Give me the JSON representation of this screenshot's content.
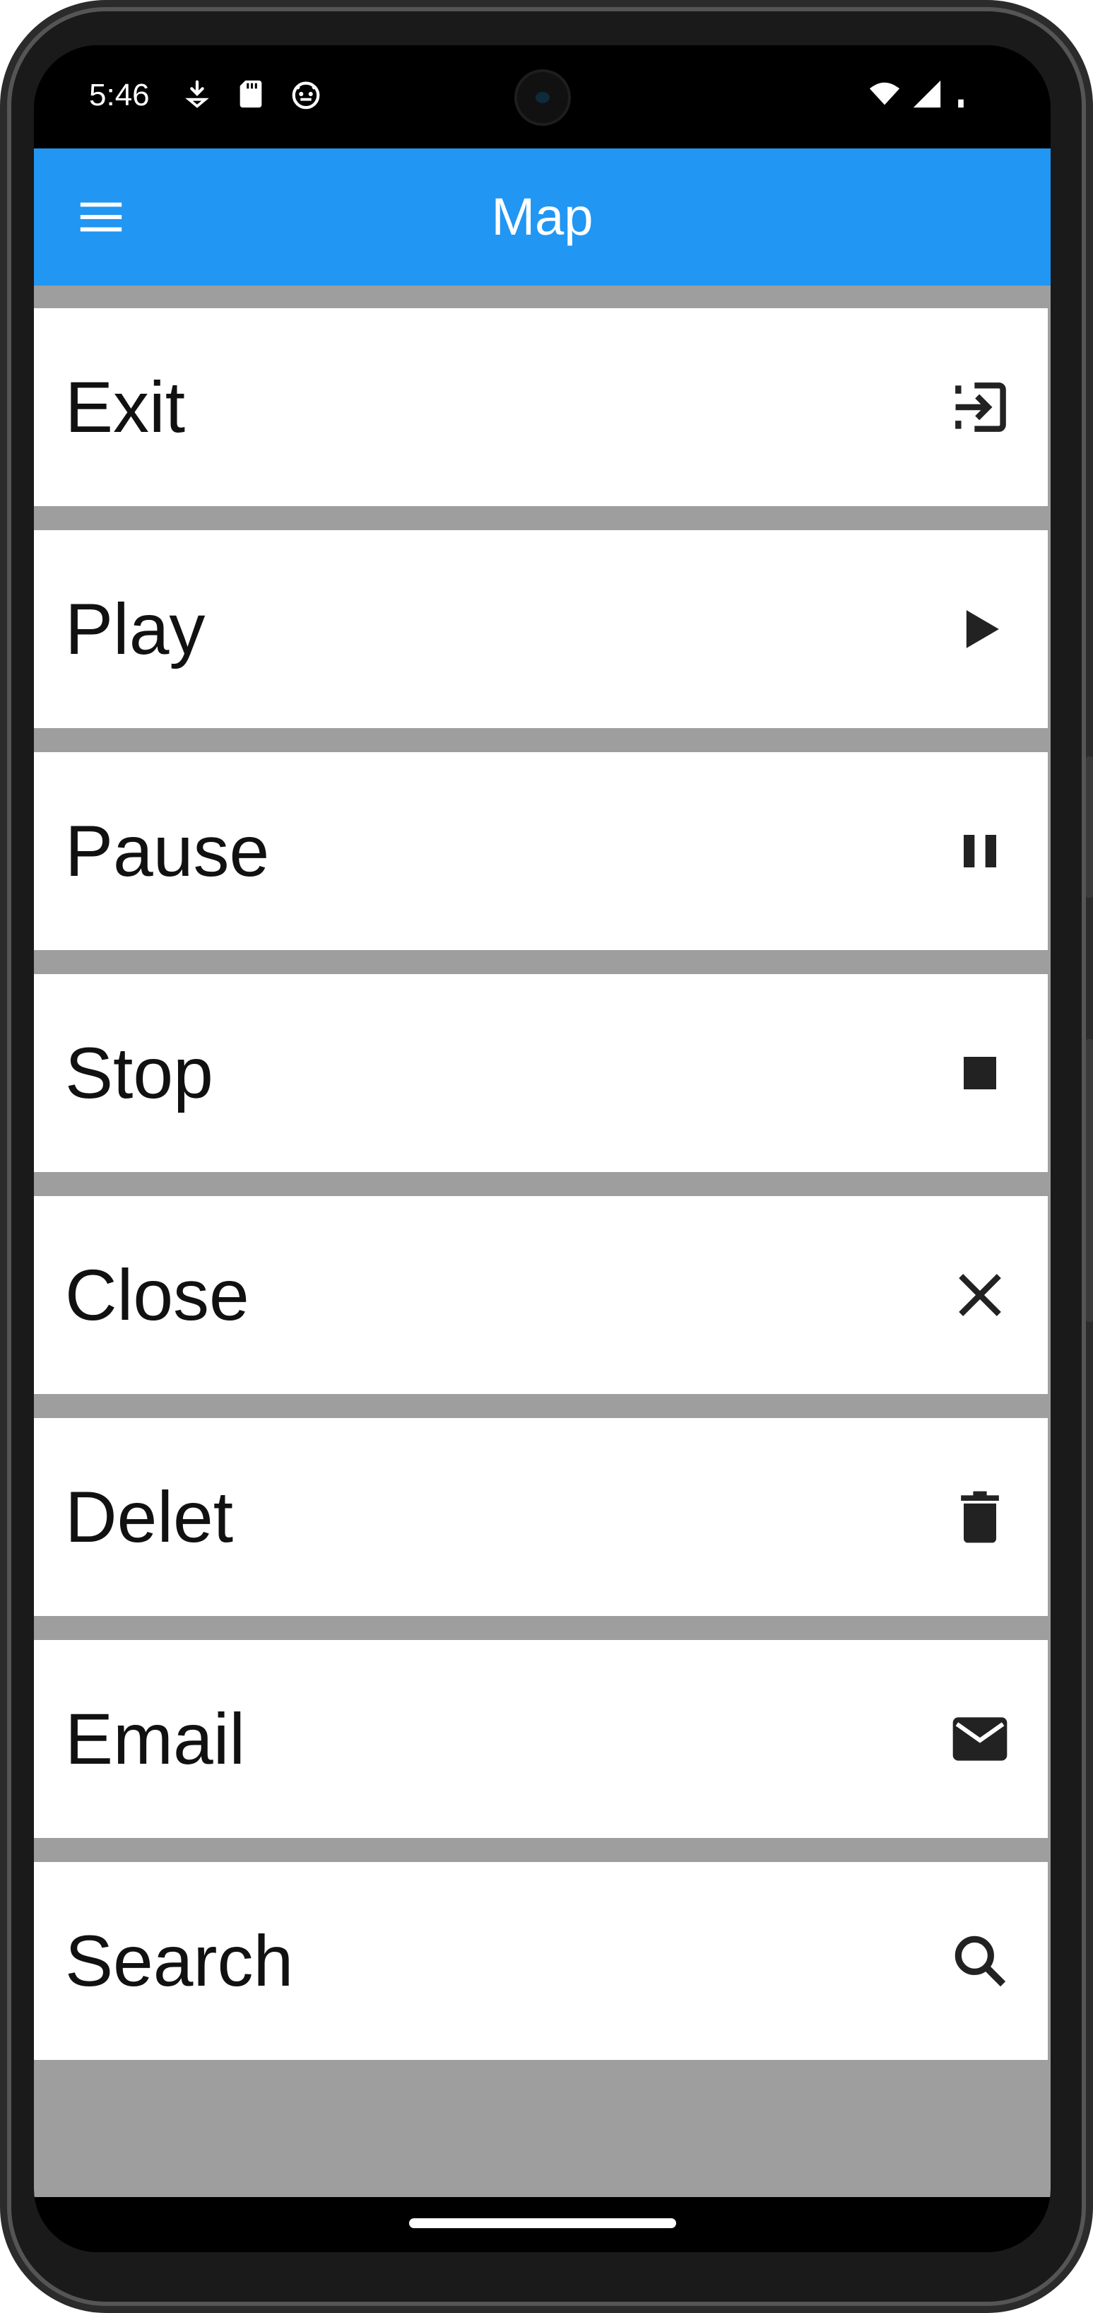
{
  "status_bar": {
    "time": "5:46",
    "left_icons": [
      "download-icon",
      "sd-card-icon",
      "robot-face-icon"
    ],
    "right_icons": [
      "wifi-icon",
      "signal-icon",
      "battery-icon"
    ]
  },
  "app_bar": {
    "title": "Map",
    "color": "#2196F3",
    "menu_icon": "hamburger-menu-icon"
  },
  "list": {
    "background": "#9e9e9e",
    "items": [
      {
        "label": "Exit",
        "icon": "exit-icon"
      },
      {
        "label": "Play",
        "icon": "play-icon"
      },
      {
        "label": "Pause",
        "icon": "pause-icon"
      },
      {
        "label": "Stop",
        "icon": "stop-icon"
      },
      {
        "label": "Close",
        "icon": "close-icon"
      },
      {
        "label": "Delet",
        "icon": "trash-icon"
      },
      {
        "label": "Email",
        "icon": "email-icon"
      },
      {
        "label": "Search",
        "icon": "search-icon"
      }
    ]
  }
}
